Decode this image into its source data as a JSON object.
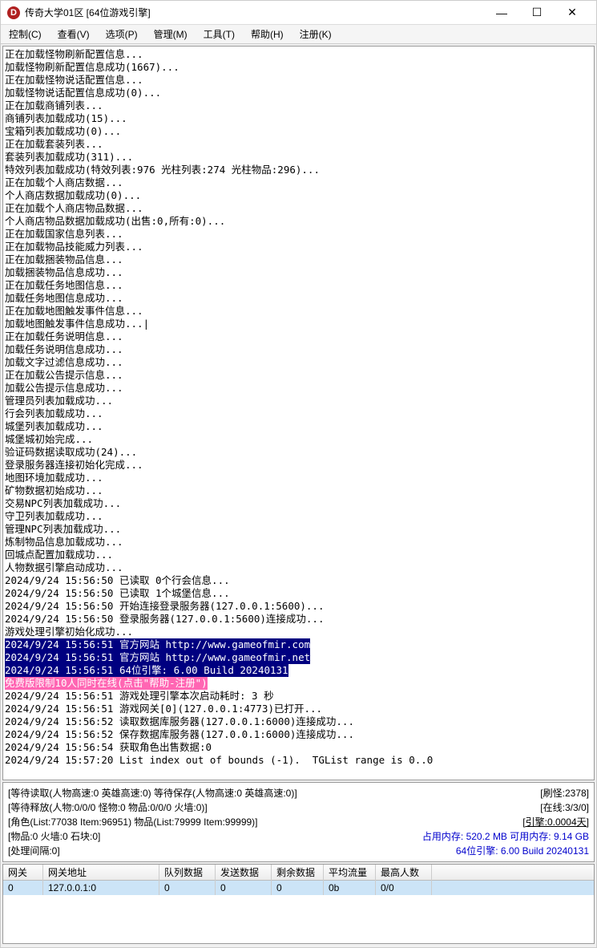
{
  "titlebar": {
    "icon_letter": "D",
    "title": "传奇大学01区 [64位游戏引擎]"
  },
  "menu": {
    "control": "控制(C)",
    "view": "查看(V)",
    "options": "选项(P)",
    "manage": "管理(M)",
    "tools": "工具(T)",
    "help": "帮助(H)",
    "register": "注册(K)"
  },
  "log": {
    "lines": [
      "正在加载怪物刷新配置信息...",
      "加载怪物刷新配置信息成功(1667)...",
      "正在加载怪物说话配置信息...",
      "加载怪物说话配置信息成功(0)...",
      "正在加载商铺列表...",
      "商铺列表加载成功(15)...",
      "宝箱列表加载成功(0)...",
      "正在加载套装列表...",
      "套装列表加载成功(311)...",
      "特效列表加载成功(特效列表:976 光柱列表:274 光柱物品:296)...",
      "正在加载个人商店数据...",
      "个人商店数据加载成功(0)...",
      "正在加载个人商店物品数据...",
      "个人商店物品数据加载成功(出售:0,所有:0)...",
      "正在加载国家信息列表...",
      "正在加载物品技能威力列表...",
      "正在加载捆装物品信息...",
      "加载捆装物品信息成功...",
      "正在加载任务地图信息...",
      "加载任务地图信息成功...",
      "正在加载地图触发事件信息...",
      "加载地图触发事件信息成功...|",
      "正在加载任务说明信息...",
      "加载任务说明信息成功...",
      "加载文字过滤信息成功...",
      "正在加载公告提示信息...",
      "加载公告提示信息成功...",
      "管理员列表加载成功...",
      "行会列表加载成功...",
      "城堡列表加载成功...",
      "城堡城初始完成...",
      "验证码数据读取成功(24)...",
      "登录服务器连接初始化完成...",
      "地图环境加载成功...",
      "矿物数据初始成功...",
      "交易NPC列表加载成功...",
      "守卫列表加载成功...",
      "管理NPC列表加载成功...",
      "炼制物品信息加载成功...",
      "回城点配置加载成功...",
      "人物数据引擎启动成功...",
      "2024/9/24 15:56:50 已读取 0个行会信息...",
      "2024/9/24 15:56:50 已读取 1个城堡信息...",
      "2024/9/24 15:56:50 开始连接登录服务器(127.0.0.1:5600)...",
      "2024/9/24 15:56:50 登录服务器(127.0.0.1:5600)连接成功...",
      "游戏处理引擎初始化成功..."
    ],
    "hl_blue": [
      "2024/9/24 15:56:51 官方网站 http://www.gameofmir.com",
      "2024/9/24 15:56:51 官方网站 http://www.gameofmir.net",
      "2024/9/24 15:56:51 64位引擎: 6.00 Build 20240131"
    ],
    "hl_pink": "免费版限制10人同时在线(点击\"帮助-注册\")",
    "lines2": [
      "2024/9/24 15:56:51 游戏处理引擎本次启动耗时: 3 秒",
      "2024/9/24 15:56:51 游戏网关[0](127.0.0.1:4773)已打开...",
      "2024/9/24 15:56:52 读取数据库服务器(127.0.0.1:6000)连接成功...",
      "2024/9/24 15:56:52 保存数据库服务器(127.0.0.1:6000)连接成功...",
      "2024/9/24 15:56:54 获取角色出售数据:0",
      "2024/9/24 15:57:20 List index out of bounds (-1).  TGList range is 0..0"
    ]
  },
  "status": {
    "l1": "[等待读取(人物高速:0 英雄高速:0) 等待保存(人物高速:0 英雄高速:0)]",
    "l2": "[等待释放(人物:0/0/0 怪物:0 物品:0/0/0 火墙:0)]",
    "l3": "[角色(List:77038 Item:96951) 物品(List:79999 Item:99999)]",
    "l4": "[物品:0 火墙:0 石块:0]",
    "l5": "[处理间隔:0]",
    "r1": "[刷怪:2378]",
    "r2": "[在线:3/3/0]",
    "r3": "[引擎:0.0004天]",
    "r4a": "占用内存: 520.2 MB",
    "r4b": "可用内存: 9.14 GB",
    "r5": "64位引擎: 6.00 Build 20240131"
  },
  "gateway": {
    "headers": [
      "网关",
      "网关地址",
      "队列数据",
      "发送数据",
      "剩余数据",
      "平均流量",
      "最高人数"
    ],
    "row": [
      "0",
      "127.0.0.1:0",
      "0",
      "0",
      "0",
      "0b",
      "0/0"
    ]
  }
}
